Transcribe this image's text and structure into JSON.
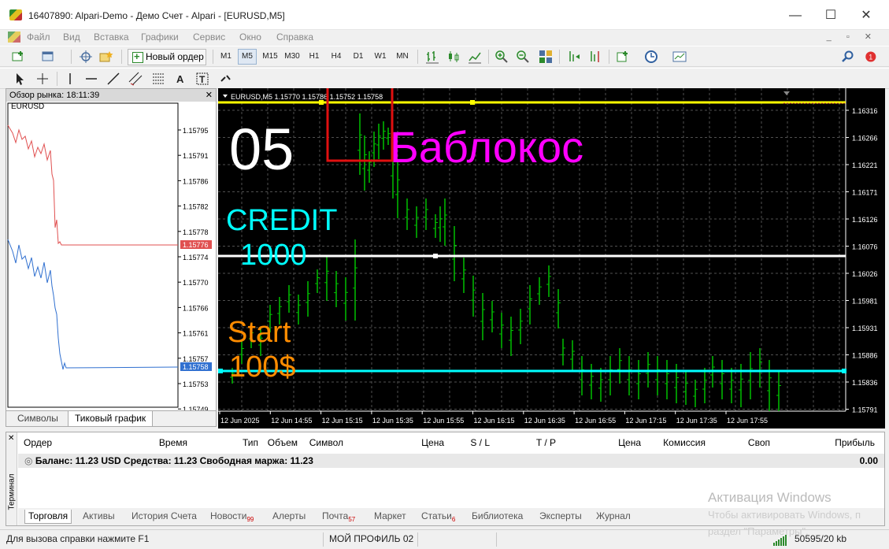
{
  "window": {
    "title": "16407890: Alpari-Demo - Демо Счет - Alpari - [EURUSD,M5]",
    "min": "—",
    "max": "☐",
    "close": "✕"
  },
  "menu": [
    "Файл",
    "Вид",
    "Вставка",
    "Графики",
    "Сервис",
    "Окно",
    "Справка"
  ],
  "toolbar": {
    "new_order": "Новый ордер",
    "timeframes": [
      "M1",
      "M5",
      "M15",
      "M30",
      "H1",
      "H4",
      "D1",
      "W1",
      "MN"
    ],
    "active_tf": "M5",
    "notif_count": "1"
  },
  "market_watch": {
    "title": "Обзор рынка: 18:11:39",
    "symbol": "EURUSD",
    "tabs": [
      "Символы",
      "Тиковый график"
    ],
    "prices": [
      "1.15795",
      "1.15791",
      "1.15786",
      "1.15782",
      "1.15778",
      "1.15774",
      "1.15770",
      "1.15766",
      "1.15761",
      "1.15757",
      "1.15753",
      "1.15749"
    ],
    "ask": "1.15776",
    "bid": "1.15758"
  },
  "chart": {
    "header": "EURUSD,M5  1.15770 1.15786 1.15752 1.15758",
    "price_labels": [
      "1.16316",
      "1.16266",
      "1.16221",
      "1.16171",
      "1.16126",
      "1.16076",
      "1.16026",
      "1.15981",
      "1.15931",
      "1.15886",
      "1.15836",
      "1.15791"
    ],
    "time_labels": [
      "12 Jun 2025",
      "12 Jun 14:55",
      "12 Jun 15:15",
      "12 Jun 15:35",
      "12 Jun 15:55",
      "12 Jun 16:15",
      "12 Jun 16:35",
      "12 Jun 16:55",
      "12 Jun 17:15",
      "12 Jun 17:35",
      "12 Jun 17:55"
    ],
    "text_05": "05",
    "text_bablokos": "Баблокос",
    "text_credit": "CREDIT",
    "text_credit_val": "1000",
    "text_start": "Start",
    "text_start_val": "100$",
    "colors": {
      "bull": "#00c000",
      "yellow": "#ffff00",
      "cyan": "#00ffff",
      "magenta": "#ff00ff",
      "orange": "#ff8c00"
    }
  },
  "terminal": {
    "side_label": "Терминал",
    "headers": [
      "Ордер",
      "Время",
      "Тип",
      "Объем",
      "Символ",
      "Цена",
      "S / L",
      "T / P",
      "Цена",
      "Комиссия",
      "Своп",
      "Прибыль"
    ],
    "balance_text": "Баланс: 11.23 USD  Средства: 11.23  Свободная маржа: 11.23",
    "profit": "0.00",
    "tabs": [
      {
        "label": "Торговля",
        "badge": ""
      },
      {
        "label": "Активы",
        "badge": ""
      },
      {
        "label": "История Счета",
        "badge": ""
      },
      {
        "label": "Новости",
        "badge": "99"
      },
      {
        "label": "Алерты",
        "badge": ""
      },
      {
        "label": "Почта",
        "badge": "57"
      },
      {
        "label": "Маркет",
        "badge": ""
      },
      {
        "label": "Статьи",
        "badge": "6"
      },
      {
        "label": "Библиотека",
        "badge": ""
      },
      {
        "label": "Эксперты",
        "badge": ""
      },
      {
        "label": "Журнал",
        "badge": ""
      }
    ]
  },
  "status": {
    "help": "Для вызова справки нажмите F1",
    "profile": "МОЙ ПРОФИЛЬ 02",
    "traffic": "50595/20 kb"
  },
  "watermark": {
    "line1": "Активация Windows",
    "line2": "Чтобы активировать Windows, п",
    "line3": "раздел \"Параметры\"."
  }
}
